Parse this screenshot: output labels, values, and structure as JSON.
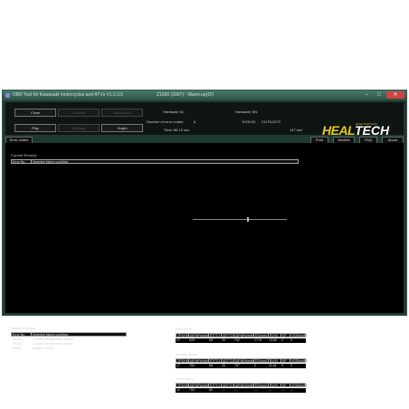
{
  "window": {
    "title": "OBD Tool for Kawasaki motorcycles and ATVs V1.0.3.5",
    "subtitle": "Z1000 (2007) - Warm-up(DI)",
    "min_label": "‒",
    "max_label": "□",
    "close_label": "✕"
  },
  "toolbar": {
    "close_label": "Close",
    "connect_label": "Connect",
    "disconnect_label": "Disconnect",
    "play_label": "Play",
    "settings_label": "Settings",
    "graph_label": "Graph",
    "hardware_id_label": "Hardware ID:",
    "hardware_id_value": "",
    "hardware_sn_label": "Hardware SN:",
    "hardware_sn_value": "",
    "num_codes_label": "Number of error codes:",
    "num_codes_value": "6",
    "ecm_id_label": "ECM ID:",
    "ecm_id_value": "21175-0272",
    "time_label": "Time: 86.19 sec",
    "time_end": "147 sec",
    "time_position": 0.58
  },
  "logo": {
    "heal": "HEAL",
    "tech": "TECH",
    "electronics": "ELECTRONICS"
  },
  "tabs": {
    "error_codes": "Error codes",
    "print": "Print",
    "models": "Models",
    "faq": "FAQ",
    "about": "About"
  },
  "current": {
    "heading": "Current Error(s):",
    "col_no": "Error No.",
    "col_cond": "Detected failure condition"
  },
  "stored": {
    "heading": "Stored Error(s):",
    "col_no": "Error No.",
    "col_cond": "Detected failure condition",
    "rows": [
      {
        "code": "P0115",
        "desc": "Coolant Temperature Sensor"
      },
      {
        "code": "P0115",
        "desc": "Coolant Temperature Sensor"
      },
      {
        "code": "P0351",
        "desc": "Ignition Coil #1"
      }
    ]
  },
  "headers": [
    "TPS(%)",
    "IAP(kPa/mHg)",
    "ET(°C)",
    "IAT(°C)",
    "IAP(kPa/mHg)",
    "ES(rpm)",
    "BV(V)",
    "SP",
    "VSS(km/h)"
  ],
  "first": {
    "heading": "First Error:",
    "values": [
      "27",
      "525",
      "68",
      "25",
      "752",
      "1776",
      "13.65",
      "0",
      "0"
    ]
  },
  "second": {
    "heading": "Second Error:",
    "values": [
      "27",
      "753",
      "68",
      "25",
      "757",
      "0",
      "11.64",
      "0",
      "0"
    ]
  },
  "third": {
    "heading": "Third Error:",
    "values": [
      "12",
      "753",
      "80",
      "---",
      "---",
      "---",
      "---",
      "---",
      "---"
    ]
  },
  "colors": {
    "accent": "#e8c820",
    "panel": "#000000",
    "frame": "#1e3a32"
  }
}
